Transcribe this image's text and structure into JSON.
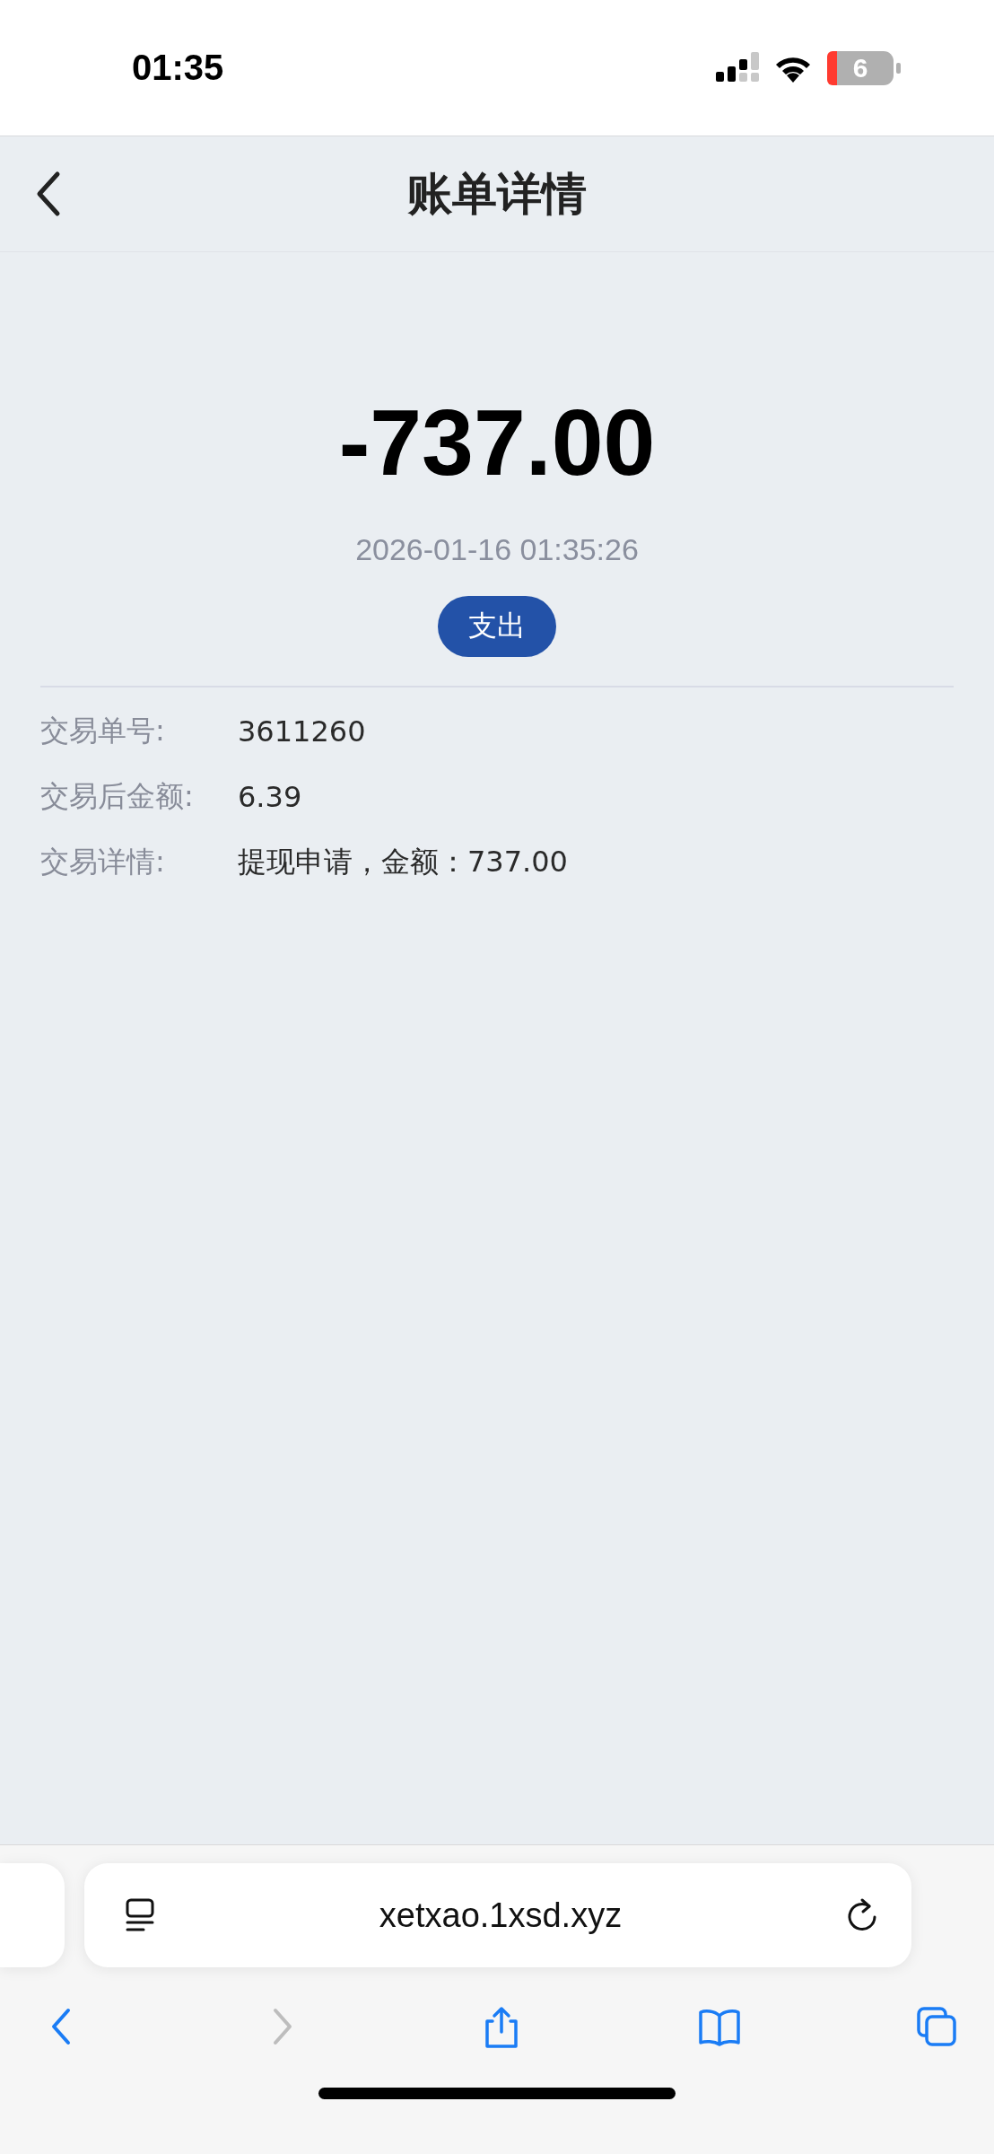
{
  "status_bar": {
    "time": "01:35",
    "battery": "6"
  },
  "header": {
    "title": "账单详情"
  },
  "transaction": {
    "amount": "-737.00",
    "time": "2026-01-16 01:35:26",
    "type_badge": "支出"
  },
  "details": [
    {
      "label": "交易单号:",
      "value": "3611260"
    },
    {
      "label": "交易后金额:",
      "value": "6.39"
    },
    {
      "label": "交易详情:",
      "value": "提现申请，金额：737.00"
    }
  ],
  "browser": {
    "url": "xetxao.1xsd.xyz",
    "toolbar": [
      {
        "kind": "back",
        "disabled": false
      },
      {
        "kind": "forward",
        "disabled": true
      },
      {
        "kind": "share",
        "disabled": false
      },
      {
        "kind": "bookmarks",
        "disabled": false
      },
      {
        "kind": "tabs",
        "disabled": false
      }
    ]
  }
}
